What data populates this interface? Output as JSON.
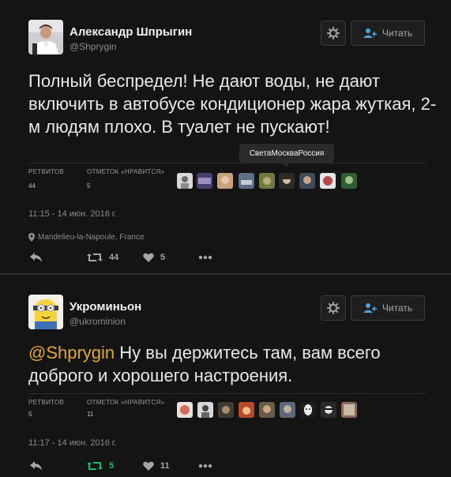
{
  "colors": {
    "background": "#141414",
    "mention": "#e3a72c",
    "retweet_active": "#17bf63",
    "text": "#e9e9e9"
  },
  "tweets": [
    {
      "author_name": "Александр Шпрыгин",
      "handle": "@Shprygin",
      "follow_label": "Читать",
      "text": "Полный беспредел! Не дают воды, не дают включить в автобусе кондиционер жара жуткая, 2-м людям плохо. В туалет не пускают!",
      "retweets_label": "РЕТВИТОВ",
      "retweets_count": "44",
      "likes_label": "ОТМЕТОК «НРАВИТСЯ»",
      "likes_count": "5",
      "timestamp": "11:15 - 14 июн. 2016 г.",
      "location": "Mandelieu-la-Napoule, France",
      "action_retweet_count": "44",
      "action_like_count": "5",
      "tooltip": "СветаМоскваРоссия",
      "icons": [
        "reply-icon",
        "retweet-icon",
        "heart-icon",
        "more-icon",
        "gear-icon",
        "follow-user-icon",
        "location-pin-icon"
      ]
    },
    {
      "author_name": "Укроминьон",
      "handle": "@ukrominion",
      "follow_label": "Читать",
      "mention": "@Shprygin",
      "text": " Ну вы держитесь там, вам всего доброго и хорошего настроения.",
      "retweets_label": "РЕТВИТОВ",
      "retweets_count": "5",
      "likes_label": "ОТМЕТОК «НРАВИТСЯ»",
      "likes_count": "11",
      "timestamp": "11:17 - 14 июн. 2016 г.",
      "action_retweet_count": "5",
      "action_like_count": "11",
      "icons": [
        "reply-icon",
        "retweet-icon",
        "heart-icon",
        "more-icon",
        "gear-icon",
        "follow-user-icon"
      ]
    }
  ]
}
